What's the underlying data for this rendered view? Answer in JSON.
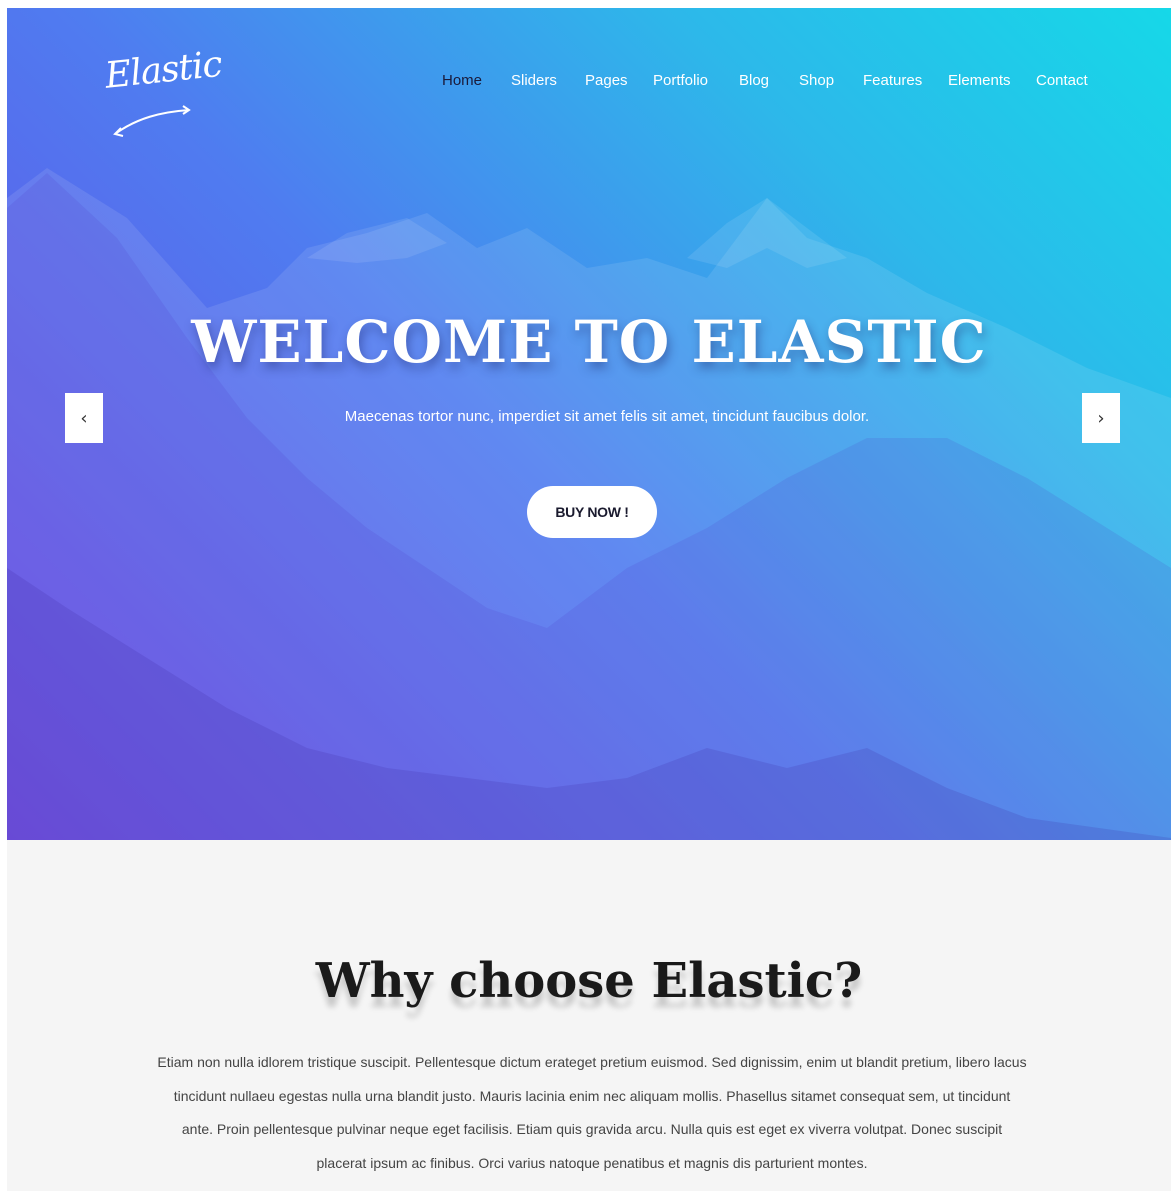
{
  "brand": {
    "logo_text": "Elastic"
  },
  "nav": {
    "items": [
      {
        "label": "Home",
        "active": true
      },
      {
        "label": "Sliders"
      },
      {
        "label": "Pages"
      },
      {
        "label": "Portfolio"
      },
      {
        "label": "Blog"
      },
      {
        "label": "Shop"
      },
      {
        "label": "Features"
      },
      {
        "label": "Elements"
      },
      {
        "label": "Contact"
      }
    ]
  },
  "hero": {
    "title": "WELCOME TO ELASTIC",
    "subtitle": "Maecenas tortor nunc, imperdiet sit amet felis sit amet, tincidunt faucibus dolor.",
    "button_label": "BUY NOW !",
    "prev_icon": "‹",
    "next_icon": "›",
    "colors": {
      "gradient_start": "#6a46e4",
      "gradient_end": "#16d8e8"
    }
  },
  "why": {
    "title": "Why choose Elastic?",
    "body": "Etiam non nulla idlorem tristique suscipit. Pellentesque dictum erateget pretium euismod. Sed dignissim, enim ut blandit pretium, libero lacus tincidunt nullaeu egestas nulla urna blandit justo. Mauris lacinia enim nec aliquam mollis. Phasellus sitamet consequat sem, ut tincidunt ante. Proin pellentesque pulvinar neque eget facilisis. Etiam quis gravida arcu. Nulla quis est eget ex viverra volutpat. Donec suscipit placerat ipsum ac finibus. Orci varius natoque penatibus et magnis dis parturient montes."
  }
}
